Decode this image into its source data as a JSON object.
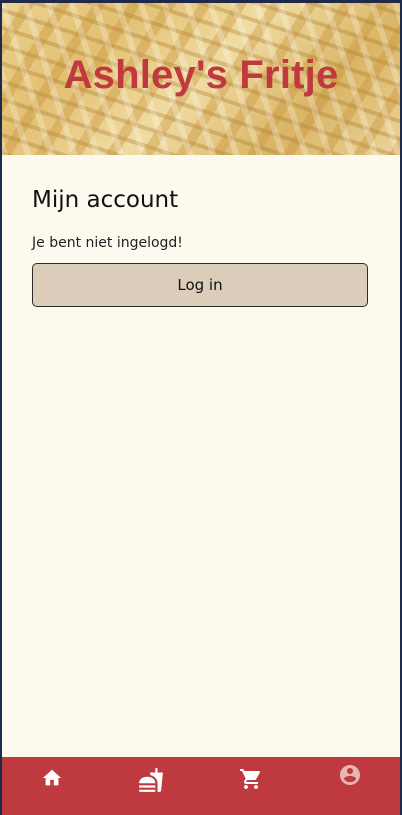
{
  "header": {
    "brand_title": "Ashley's Fritje"
  },
  "account": {
    "title": "Mijn account",
    "status": "Je bent niet ingelogd!",
    "login_label": "Log in"
  },
  "bottom_nav": {
    "items": [
      {
        "icon": "home-icon"
      },
      {
        "icon": "fastfood-icon"
      },
      {
        "icon": "cart-icon"
      },
      {
        "icon": "account-icon",
        "active": true
      }
    ]
  },
  "colors": {
    "brand_red": "#c0393f",
    "page_background": "#fcf9ee",
    "button_background": "#dbcdb9",
    "nav_icon": "#ffffff",
    "nav_icon_active": "#e6b6b0"
  }
}
